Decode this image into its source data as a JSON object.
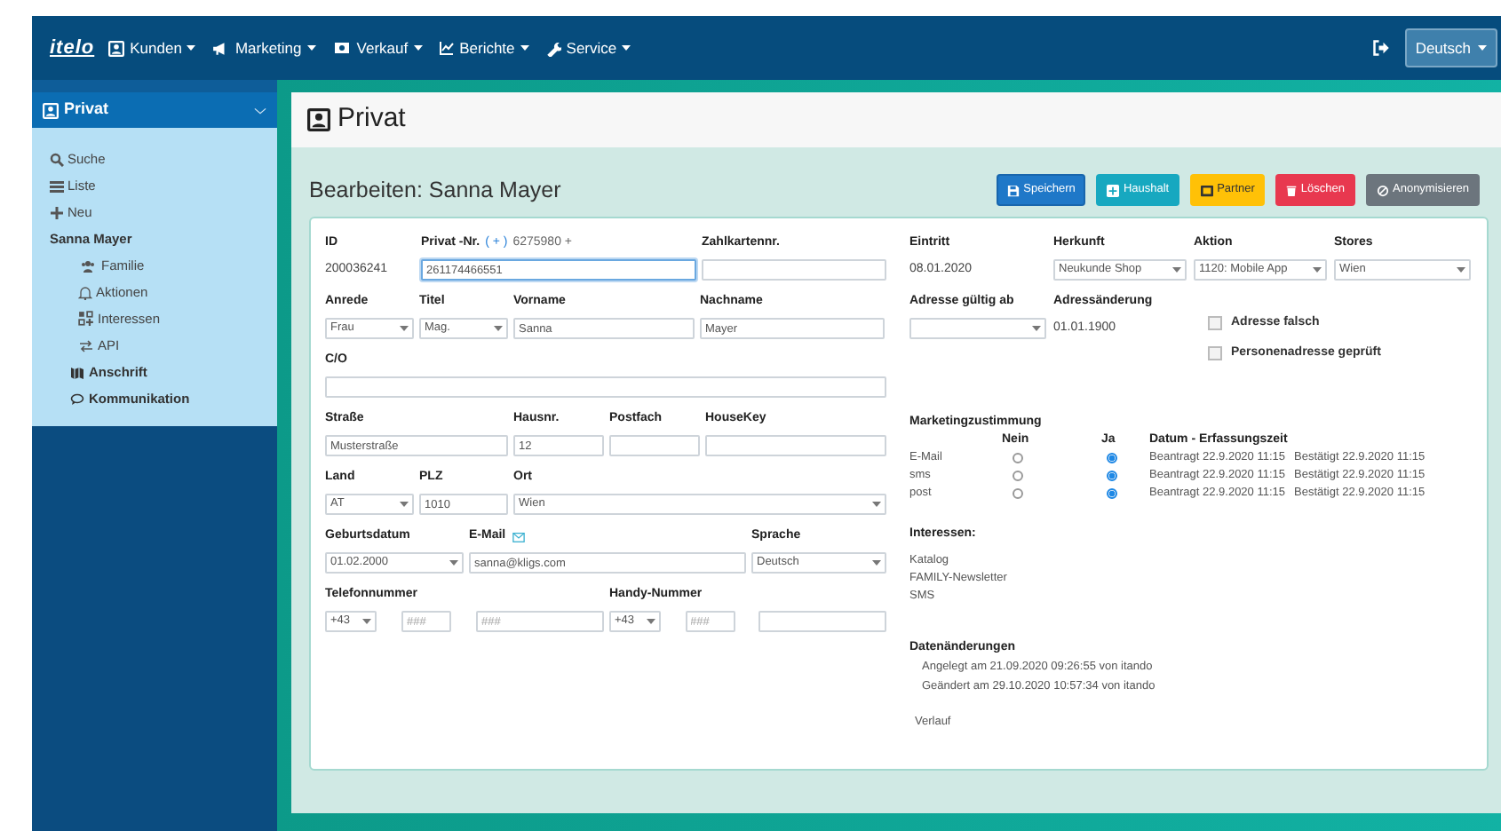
{
  "navbar": {
    "logo": "itelo",
    "menus": [
      {
        "label": "Kunden"
      },
      {
        "label": "Marketing"
      },
      {
        "label": "Verkauf"
      },
      {
        "label": "Berichte"
      },
      {
        "label": "Service"
      }
    ],
    "language": "Deutsch"
  },
  "sidebar": {
    "title": "Privat",
    "items": [
      {
        "label": "Suche",
        "kind": "link"
      },
      {
        "label": "Liste",
        "kind": "link"
      },
      {
        "label": "Neu",
        "kind": "link"
      },
      {
        "label": "Sanna Mayer",
        "kind": "heading",
        "children": [
          {
            "label": "Familie",
            "kind": "link"
          },
          {
            "label": "Aktionen",
            "kind": "link"
          },
          {
            "label": "Interessen",
            "kind": "link"
          },
          {
            "label": "API",
            "kind": "link"
          },
          {
            "label": "Anschrift",
            "kind": "group"
          },
          {
            "label": "Kommunikation",
            "kind": "group"
          }
        ]
      }
    ]
  },
  "page": {
    "title": "Privat",
    "heading": "Bearbeiten: Sanna Mayer",
    "buttons": [
      {
        "label": "Speichern",
        "kind": "primary"
      },
      {
        "label": "Haushalt",
        "kind": "info"
      },
      {
        "label": "Partner",
        "kind": "warning"
      },
      {
        "label": "Löschen",
        "kind": "danger"
      },
      {
        "label": "Anonymisieren",
        "kind": "secondary"
      }
    ]
  },
  "form": {
    "left_rows": [
      [
        {
          "label": "ID",
          "kind": "static",
          "value": "200036241"
        },
        {
          "label": "Privat -Nr.",
          "link": "( + )",
          "note": "6275980 +",
          "kind": "input",
          "value": "261174466551",
          "focused": true
        },
        {
          "label": "Zahlkartennr.",
          "kind": "input"
        }
      ],
      [
        {
          "label": "Anrede",
          "kind": "select",
          "value": "Frau"
        },
        {
          "label": "Titel",
          "kind": "select",
          "value": "Mag."
        },
        {
          "label": "Vorname",
          "kind": "input",
          "value": "Sanna"
        },
        {
          "label": "Nachname",
          "kind": "input",
          "value": "Mayer"
        }
      ],
      [
        {
          "label": "C/O",
          "kind": "input"
        }
      ],
      [
        {
          "label": "Straße",
          "kind": "input",
          "value": "Musterstraße"
        },
        {
          "label": "Hausnr.",
          "kind": "input",
          "value": "12"
        },
        {
          "label": "Postfach",
          "kind": "input"
        },
        {
          "label": "HouseKey",
          "kind": "input"
        }
      ],
      [
        {
          "label": "Land",
          "kind": "select",
          "value": "AT"
        },
        {
          "label": "PLZ",
          "kind": "input",
          "value": "1010"
        },
        {
          "label": "Ort",
          "kind": "select",
          "value": "Wien"
        }
      ],
      [
        {
          "label": "Geburtsdatum",
          "kind": "select",
          "value": "01.02.2000"
        },
        {
          "label": "E-Mail",
          "mail_icon": true,
          "kind": "input",
          "value": "sanna@kligs.com"
        },
        {
          "label": "Sprache",
          "kind": "select",
          "value": "Deutsch"
        }
      ]
    ],
    "phone_groups": [
      {
        "label": "Telefonnummer",
        "fields": [
          {
            "kind": "select",
            "value": "+43"
          },
          {
            "kind": "input",
            "placeholder": "###"
          },
          {
            "kind": "input",
            "placeholder": "###"
          }
        ]
      },
      {
        "label": "Handy-Nummer",
        "fields": [
          {
            "kind": "select",
            "value": "+43"
          },
          {
            "kind": "input",
            "placeholder": "###"
          },
          {
            "kind": "input"
          }
        ]
      }
    ],
    "right_rows": [
      [
        {
          "label": "Eintritt",
          "kind": "static",
          "value": "08.01.2020"
        },
        {
          "label": "Herkunft",
          "kind": "select",
          "value": "Neukunde Shop"
        },
        {
          "label": "Aktion",
          "kind": "select",
          "value": "1120: Mobile App"
        },
        {
          "label": "Stores",
          "kind": "select",
          "value": "Wien"
        }
      ],
      [
        {
          "label": "Adresse gültig ab",
          "kind": "select"
        },
        {
          "label": "Adressänderung",
          "kind": "static",
          "value": "01.01.1900"
        }
      ]
    ],
    "checkboxes": [
      {
        "label": "Adresse falsch",
        "checked": false
      },
      {
        "label": "Personenadresse geprüft",
        "checked": false
      }
    ],
    "marketing": {
      "title": "Marketingzustimmung",
      "columns": [
        "Nein",
        "Ja",
        "Datum - Erfassungszeit"
      ],
      "rows": [
        {
          "channel": "E-Mail",
          "nein": false,
          "ja": true,
          "requested": "Beantragt 22.9.2020 11:15",
          "confirmed": "Bestätigt 22.9.2020 11:15"
        },
        {
          "channel": "sms",
          "nein": false,
          "ja": true,
          "requested": "Beantragt 22.9.2020 11:15",
          "confirmed": "Bestätigt 22.9.2020 11:15"
        },
        {
          "channel": "post",
          "nein": false,
          "ja": true,
          "requested": "Beantragt 22.9.2020 11:15",
          "confirmed": "Bestätigt 22.9.2020 11:15"
        }
      ]
    },
    "interests": {
      "title": "Interessen:",
      "items": [
        "Katalog",
        "FAMILY-Newsletter",
        "SMS"
      ]
    },
    "changes": {
      "title": "Datenänderungen",
      "lines": [
        "Angelegt am 21.09.2020 09:26:55 von itando",
        "Geändert am 29.10.2020 10:57:34 von itando"
      ],
      "link": "Verlauf"
    }
  }
}
